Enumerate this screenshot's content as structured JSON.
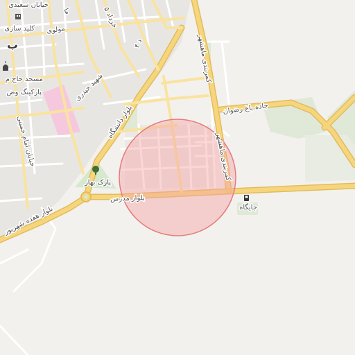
{
  "map": {
    "colors": {
      "background": "#f3f1ee",
      "major_road": "#f6d67c",
      "major_road_casing": "#e3bb5e",
      "minor_road": "#ffffff",
      "park": "#d6e8cd",
      "hospital": "#f6c8de",
      "highlight_fill": "#f5a3a3",
      "highlight_stroke": "#e57c7c"
    },
    "labels": {
      "street_saeedi": "خیابان سعیدی",
      "keyd_sazi": "کلید سازی",
      "mowlavi": "مولوی",
      "mosque": "مسجد حاج م",
      "parking": "پارکینگ وض",
      "imam_khomeini": "خیابان امام خمینی",
      "shahid_heydari": "شهید حیدری",
      "bolvar_daneshgah": "بلوار دانشگاه",
      "park_bahar": "پارک بهار",
      "bolvar_modarres": "بلوار مدرس",
      "bolvar_17_shahrivar": "بلوار هفده شهریور",
      "kamarbandi_1": "کمربندی ماهشهر",
      "kamarbandi_2": "کمربندی ماهشهر",
      "jadeh_bagh_rezvan": "جاده باغ رضوان",
      "jaygah": "جایگاه",
      "partial_top_left": "ب",
      "partial_top": "ما",
      "partial_top2": "د ۴",
      "partial_khordad": "۵ خرداد"
    },
    "icons": [
      "building-icon",
      "mosque-icon",
      "tree-icon",
      "fuel-icon"
    ]
  }
}
